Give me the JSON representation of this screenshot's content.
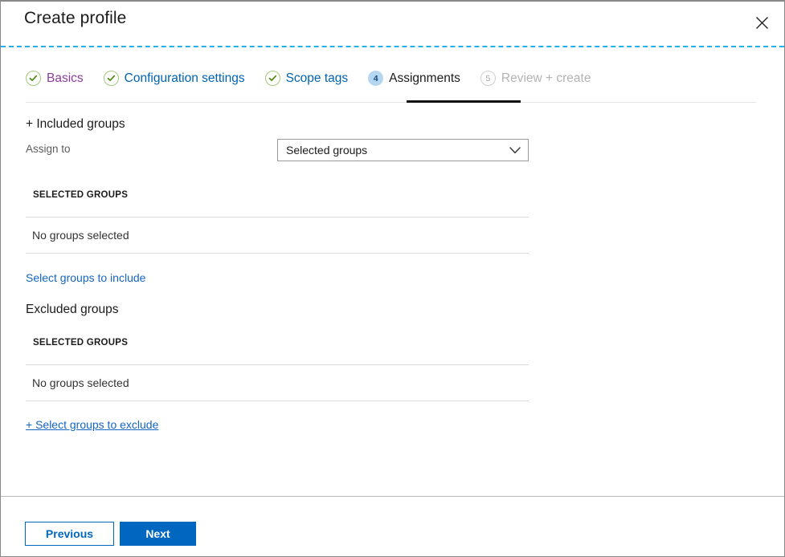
{
  "window": {
    "title": "Create profile",
    "close_icon": "close-icon"
  },
  "wizard": {
    "tabs": [
      {
        "label": "Basics",
        "badge": "✓",
        "state": "visited"
      },
      {
        "label": "Configuration settings",
        "badge": "✓",
        "state": "done"
      },
      {
        "label": "Scope tags",
        "badge": "✓",
        "state": "done"
      },
      {
        "label": "Assignments",
        "badge": "4",
        "state": "current"
      },
      {
        "label": "Review + create",
        "badge": "5",
        "state": "disabled"
      }
    ]
  },
  "included": {
    "heading": "+ Included groups",
    "assign_to_label": "Assign to",
    "assign_to_value": "Selected groups",
    "assign_to_options": [
      "Selected groups"
    ],
    "column_header": "SELECTED GROUPS",
    "empty_text": "No groups selected",
    "link_text": "Select groups to include"
  },
  "excluded": {
    "heading": "Excluded groups",
    "column_header": "SELECTED GROUPS",
    "empty_text": "No groups selected",
    "link_text": "+ Select groups to exclude"
  },
  "footer": {
    "previous_label": "Previous",
    "next_label": "Next"
  },
  "colors": {
    "accent": "#0067c0",
    "link": "#1565c0",
    "visited": "#8c3d9c",
    "check": "#4f8a10",
    "badge_active_bg": "#b5d6f0",
    "dashed_rule": "#22b0e8"
  }
}
